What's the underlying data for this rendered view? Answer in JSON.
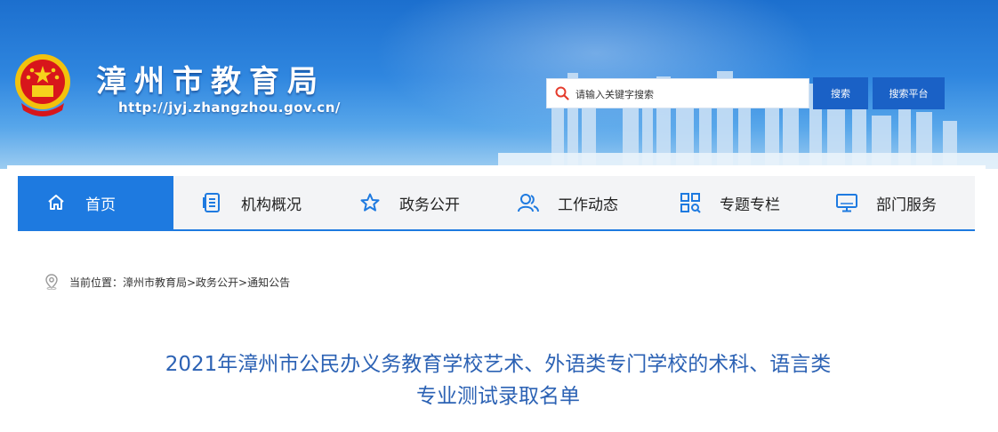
{
  "site": {
    "title": "漳州市教育局",
    "url": "http://jyj.zhangzhou.gov.cn/"
  },
  "search": {
    "placeholder": "请输入关键字搜索",
    "search_label": "搜索",
    "platform_label": "搜索平台"
  },
  "nav": {
    "items": [
      {
        "label": "首页",
        "icon": "home-icon"
      },
      {
        "label": "机构概况",
        "icon": "document-list-icon"
      },
      {
        "label": "政务公开",
        "icon": "star-icon"
      },
      {
        "label": "工作动态",
        "icon": "people-icon"
      },
      {
        "label": "专题专栏",
        "icon": "grid-search-icon"
      },
      {
        "label": "部门服务",
        "icon": "monitor-icon"
      }
    ]
  },
  "breadcrumb": {
    "text": "当前位置：漳州市教育局>政务公开>通知公告"
  },
  "article": {
    "title_line1": "2021年漳州市公民办义务教育学校艺术、外语类专门学校的术科、语言类",
    "title_line2": "专业测试录取名单"
  },
  "colors": {
    "accent": "#1e7ae0",
    "button": "#1a61c6",
    "title": "#2c62b4"
  }
}
